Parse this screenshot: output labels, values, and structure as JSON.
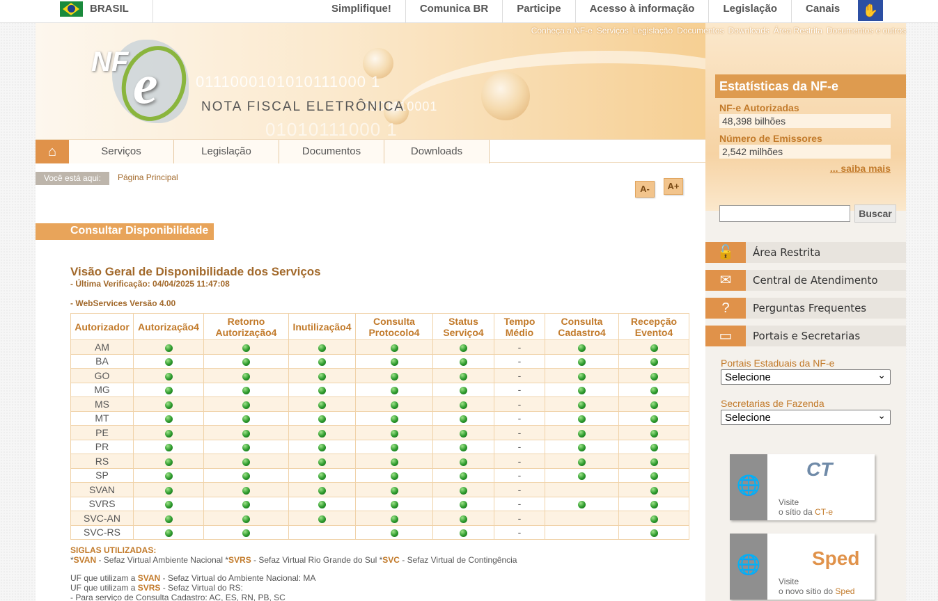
{
  "gov": {
    "brasil": "BRASIL",
    "links": [
      "Simplifique!",
      "Comunica BR",
      "Participe",
      "Acesso à informação",
      "Legislação",
      "Canais"
    ]
  },
  "banner": {
    "toplinks": [
      "Conheça a NF-e",
      "Serviços",
      "Legislação",
      "Documentos",
      "Downloads",
      "Área Restrita",
      "Documentos e outros"
    ],
    "logo_nf": "NF",
    "logo_e": "e",
    "brand": "NOTA FISCAL ELETRÔNICA"
  },
  "nav": {
    "items": [
      "Serviços",
      "Legislação",
      "Documentos",
      "Downloads"
    ]
  },
  "breadcrumb": {
    "label": "Você está aqui:",
    "value": "Página Principal"
  },
  "fontsize": {
    "decrease": "A-",
    "increase": "A+"
  },
  "content": {
    "section_title": "Consultar Disponibilidade",
    "heading": "Visão Geral de Disponibilidade dos Serviços",
    "last_check": "- Última Verificação: 04/04/2025 11:47:08",
    "version": "- WebServices Versão 4.00",
    "table": {
      "headers": [
        [
          "Autorizador"
        ],
        [
          "Autorização4"
        ],
        [
          "Retorno",
          "Autorização4"
        ],
        [
          "Inutilização4"
        ],
        [
          "Consulta",
          "Protocolo4"
        ],
        [
          "Status",
          "Serviço4"
        ],
        [
          "Tempo",
          "Médio"
        ],
        [
          "Consulta",
          "Cadastro4"
        ],
        [
          "Recepção",
          "Evento4"
        ]
      ],
      "rows": [
        {
          "name": "AM",
          "cells": [
            "ok",
            "ok",
            "ok",
            "ok",
            "ok",
            "-",
            "ok",
            "ok"
          ]
        },
        {
          "name": "BA",
          "cells": [
            "ok",
            "ok",
            "ok",
            "ok",
            "ok",
            "-",
            "ok",
            "ok"
          ]
        },
        {
          "name": "GO",
          "cells": [
            "ok",
            "ok",
            "ok",
            "ok",
            "ok",
            "-",
            "ok",
            "ok"
          ]
        },
        {
          "name": "MG",
          "cells": [
            "ok",
            "ok",
            "ok",
            "ok",
            "ok",
            "-",
            "ok",
            "ok"
          ]
        },
        {
          "name": "MS",
          "cells": [
            "ok",
            "ok",
            "ok",
            "ok",
            "ok",
            "-",
            "ok",
            "ok"
          ]
        },
        {
          "name": "MT",
          "cells": [
            "ok",
            "ok",
            "ok",
            "ok",
            "ok",
            "-",
            "ok",
            "ok"
          ]
        },
        {
          "name": "PE",
          "cells": [
            "ok",
            "ok",
            "ok",
            "ok",
            "ok",
            "-",
            "ok",
            "ok"
          ]
        },
        {
          "name": "PR",
          "cells": [
            "ok",
            "ok",
            "ok",
            "ok",
            "ok",
            "-",
            "ok",
            "ok"
          ]
        },
        {
          "name": "RS",
          "cells": [
            "ok",
            "ok",
            "ok",
            "ok",
            "ok",
            "-",
            "ok",
            "ok"
          ]
        },
        {
          "name": "SP",
          "cells": [
            "ok",
            "ok",
            "ok",
            "ok",
            "ok",
            "-",
            "ok",
            "ok"
          ]
        },
        {
          "name": "SVAN",
          "cells": [
            "ok",
            "ok",
            "ok",
            "ok",
            "ok",
            "-",
            "",
            "ok"
          ]
        },
        {
          "name": "SVRS",
          "cells": [
            "ok",
            "ok",
            "ok",
            "ok",
            "ok",
            "-",
            "ok",
            "ok"
          ]
        },
        {
          "name": "SVC-AN",
          "cells": [
            "ok",
            "ok",
            "ok",
            "ok",
            "ok",
            "-",
            "",
            "ok"
          ]
        },
        {
          "name": "SVC-RS",
          "cells": [
            "ok",
            "ok",
            "",
            "ok",
            "ok",
            "-",
            "",
            "ok"
          ]
        }
      ]
    },
    "siglas_title": "SIGLAS UTILIZADAS:",
    "siglas": [
      {
        "code": "SVAN",
        "desc": " - Sefaz Virtual Ambiente Nacional "
      },
      {
        "code": "SVRS",
        "desc": " - Sefaz Virtual Rio Grande do Sul "
      },
      {
        "code": "SVC",
        "desc": " - Sefaz Virtual de Contingência"
      }
    ],
    "uf_svan_pre": "UF que utilizam a ",
    "uf_svan_code": "SVAN",
    "uf_svan_post": " - Sefaz Virtual do Ambiente Nacional: MA",
    "uf_svrs_pre": "UF que utilizam a ",
    "uf_svrs_code": "SVRS",
    "uf_svrs_post": " - Sefaz Virtual do RS:",
    "uf_svrs_line2": "- Para serviço de Consulta Cadastro: AC, ES, RN, PB, SC"
  },
  "sidebar": {
    "stats_title": "Estatísticas da NF-e",
    "authorized_label": "NF-e Autorizadas",
    "authorized_value": "48,398 bilhões",
    "emitters_label": "Número de Emissores",
    "emitters_value": "2,542 milhões",
    "more": "... saiba mais",
    "search_button": "Buscar",
    "menu": [
      "Área Restrita",
      "Central de Atendimento",
      "Perguntas Frequentes",
      "Portais e Secretarias"
    ],
    "portais_label": "Portais Estaduais da NF-e",
    "portais_value": "Selecione",
    "secretarias_label": "Secretarias de Fazenda",
    "secretarias_value": "Selecione",
    "promo_visit": "Visite",
    "promo_cte_pre": "o sítio da ",
    "promo_cte_name": "CT-e",
    "promo_cte_logo": "CT",
    "promo_sped_pre": "o novo sítio do ",
    "promo_sped_name": "Sped",
    "promo_sped_logo": "Sped"
  }
}
